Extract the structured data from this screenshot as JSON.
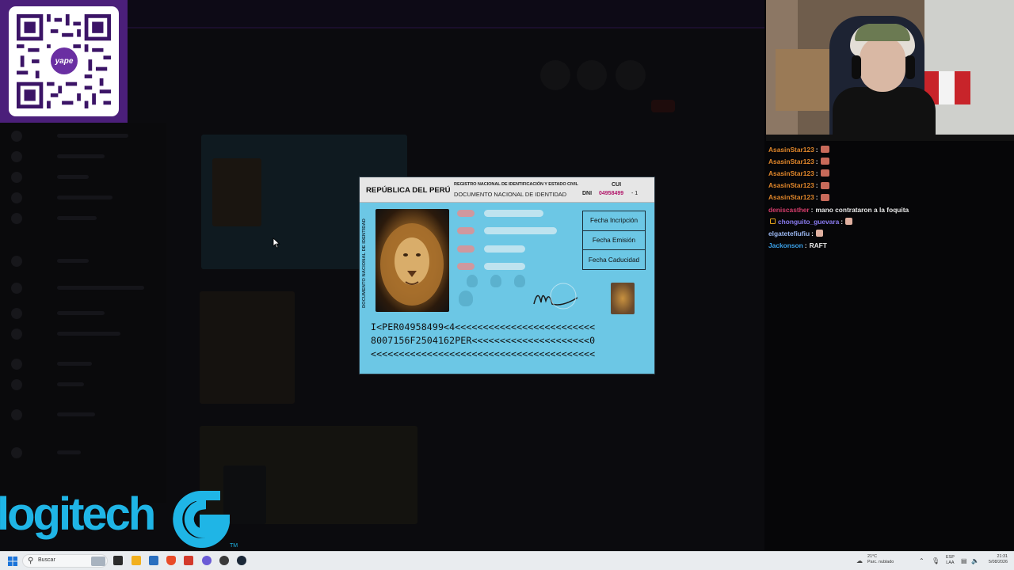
{
  "qr_overlay": {
    "brand": "yape"
  },
  "chat": {
    "messages": [
      {
        "user": "AsasinStar123",
        "color": "#e0862a",
        "text": "",
        "emote": true
      },
      {
        "user": "AsasinStar123",
        "color": "#e0862a",
        "text": "",
        "emote": true
      },
      {
        "user": "AsasinStar123",
        "color": "#e0862a",
        "text": "",
        "emote": true
      },
      {
        "user": "AsasinStar123",
        "color": "#e0862a",
        "text": "",
        "emote": true
      },
      {
        "user": "AsasinStar123",
        "color": "#e0862a",
        "text": "",
        "emote": true
      },
      {
        "user": "deniscasther",
        "color": "#d63d6b",
        "text": "mano contrataron a la foquita",
        "emote": false
      },
      {
        "user": "chonguito_guevara",
        "color": "#8a7bf0",
        "text": "",
        "emote": true
      },
      {
        "user": "elgatetefiufiu",
        "color": "#9ab6f0",
        "text": "",
        "emote": true
      },
      {
        "user": "Jackonson",
        "color": "#3aa0e8",
        "text": "RAFT",
        "emote": false
      }
    ]
  },
  "id_card": {
    "country": "REPÚBLICA DEL PERÚ",
    "registry": "REGISTRO NACIONAL DE IDENTIFICACIÓN Y ESTADO CIVIL",
    "doc_type": "DOCUMENTO NACIONAL DE IDENTIDAD",
    "cui_label": "CUI",
    "dni_label": "DNI",
    "dni_number": "04958499",
    "dni_check": "- 1",
    "vertical_text": "DOCUMENTO NACIONAL DE IDENTIDAD",
    "date_fields": [
      "Fecha Incripción",
      "Fecha Emisión",
      "Fecha Caducidad"
    ],
    "mrz": [
      "I<PER04958499<4<<<<<<<<<<<<<<<<<<<<<<<<<",
      "8007156F2504162PER<<<<<<<<<<<<<<<<<<<<<0",
      "<<<<<<<<<<<<<<<<<<<<<<<<<<<<<<<<<<<<<<<<"
    ]
  },
  "sponsor": {
    "name": "logitech",
    "tm": "TM"
  },
  "taskbar": {
    "search_placeholder": "Buscar",
    "weather_temp": "21°C",
    "weather_desc": "Parc. nublado",
    "lang_top": "ESP",
    "lang_bottom": "LAA",
    "time": "21:31",
    "date": "5/08/2026"
  }
}
